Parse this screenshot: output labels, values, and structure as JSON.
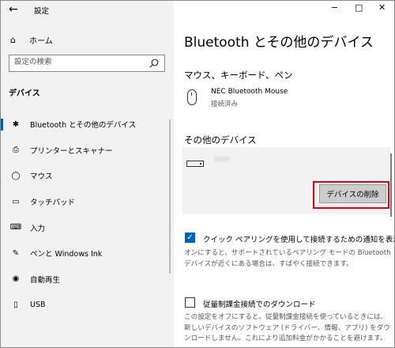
{
  "window": {
    "title": "設定",
    "back_icon": "←",
    "minimize_icon": "−",
    "maximize_icon": "□",
    "close_icon": "✕"
  },
  "sidebar": {
    "home_label": "ホーム",
    "home_icon": "⌂",
    "search_placeholder": "設定の検索",
    "section_label": "デバイス",
    "items": [
      {
        "label": "Bluetooth とその他のデバイス",
        "icon": "bluetooth-icon",
        "glyph": "✱",
        "active": true
      },
      {
        "label": "プリンターとスキャナー",
        "icon": "printer-icon",
        "glyph": "⎙",
        "active": false
      },
      {
        "label": "マウス",
        "icon": "mouse-icon",
        "glyph": "◯",
        "active": false
      },
      {
        "label": "タッチパッド",
        "icon": "touchpad-icon",
        "glyph": "▭",
        "active": false
      },
      {
        "label": "入力",
        "icon": "keyboard-icon",
        "glyph": "⌨",
        "active": false
      },
      {
        "label": "ペンと Windows Ink",
        "icon": "pen-icon",
        "glyph": "✎",
        "active": false
      },
      {
        "label": "自動再生",
        "icon": "autoplay-icon",
        "glyph": "◉",
        "active": false
      },
      {
        "label": "USB",
        "icon": "usb-icon",
        "glyph": "▯",
        "active": false
      }
    ]
  },
  "main": {
    "title": "Bluetooth とその他のデバイス",
    "mouse_section": {
      "heading": "マウス、キーボード、ペン",
      "device_name": "NEC Bluetooth Mouse",
      "device_status": "接続済み"
    },
    "other_section": {
      "heading": "その他のデバイス",
      "device_name": "MRM",
      "remove_button": "デバイスの削除"
    },
    "swift_pair": {
      "label": "クイック ペアリングを使用して接続するための通知を表示する",
      "checked": true,
      "description": "オンにすると、サポートされているペアリング モードの Bluetooth デバイスが近くにある場合は、すばやく接続できます。"
    },
    "metered": {
      "label": "従量制課金接続でのダウンロード",
      "checked": false,
      "description": "この設定をオフにすると、従量制課金接続を使っているときには、新しいデバイスのソフトウェア (ドライバー、情報、アプリ) をダウンロードしません。これにより追加料金がかかることを避けます。"
    }
  },
  "colors": {
    "accent": "#0063b1",
    "highlight": "#e60012",
    "sidebar_bg": "#f2f2f2",
    "card_bg": "#f2f2f2"
  }
}
